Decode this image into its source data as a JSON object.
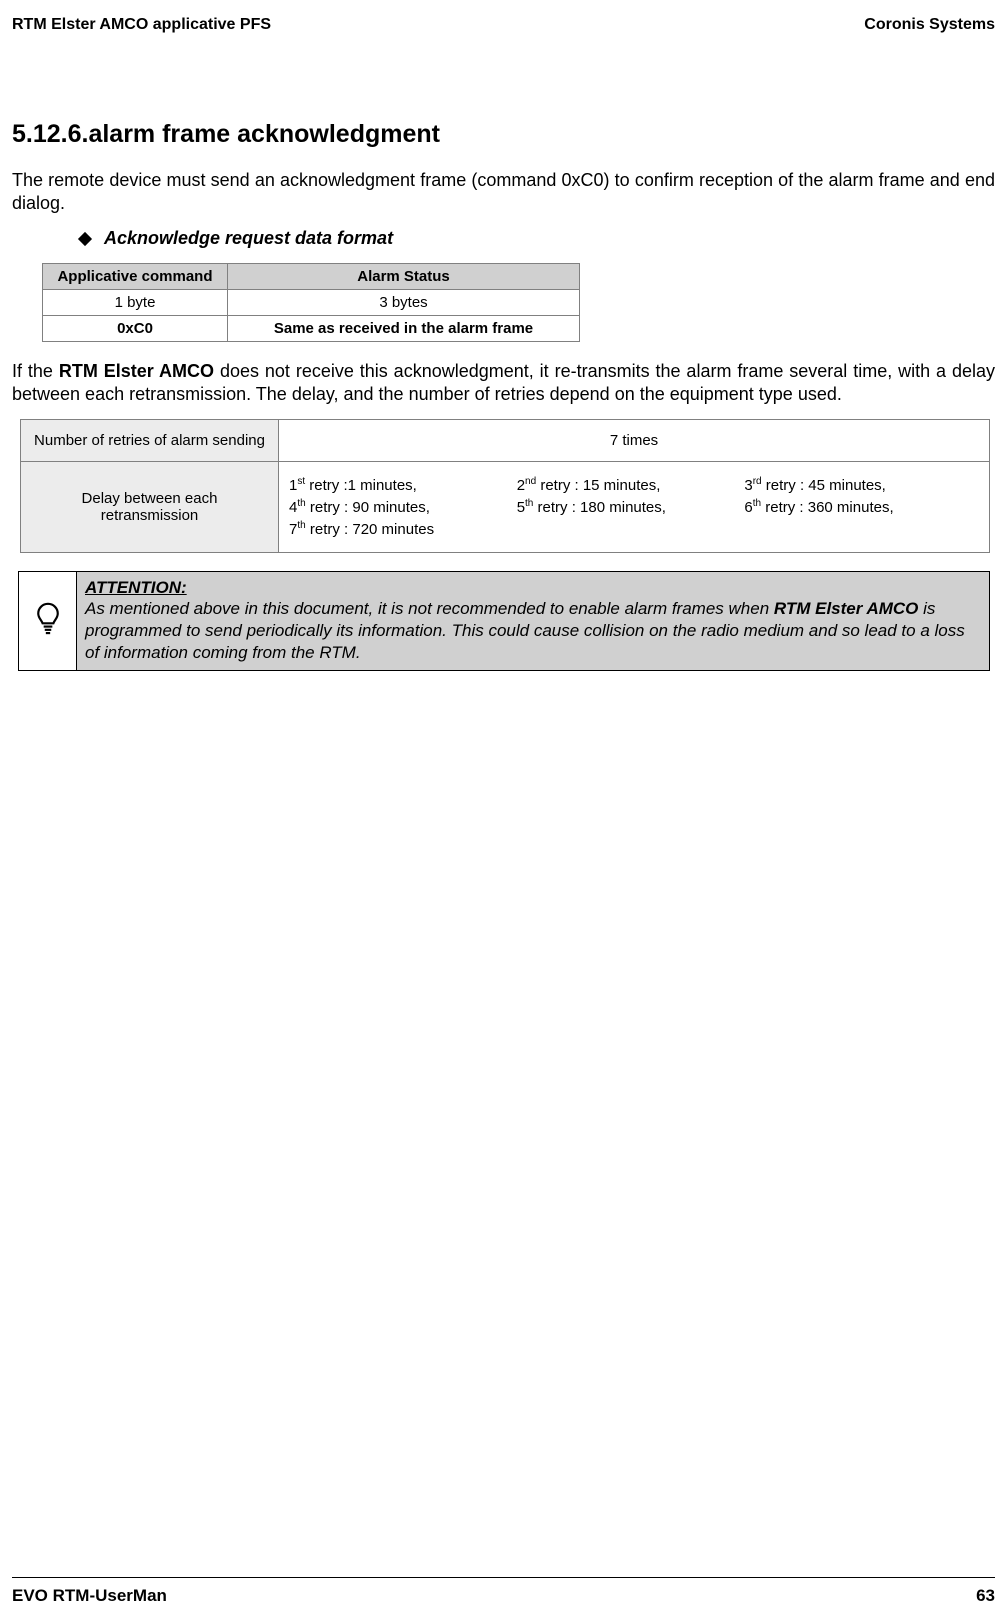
{
  "header": {
    "left": "RTM Elster AMCO applicative PFS",
    "right": "Coronis Systems"
  },
  "section": {
    "heading": "5.12.6.alarm frame acknowledgment"
  },
  "para1": "The remote device must send an acknowledgment frame (command 0xC0) to confirm reception of the alarm frame and end dialog.",
  "bullet": {
    "text": "Acknowledge request data format"
  },
  "table1": {
    "h1": "Applicative command",
    "h2": "Alarm Status",
    "r1c1": "1 byte",
    "r1c2": "3 bytes",
    "r2c1": "0xC0",
    "r2c2": "Same as received in the alarm frame"
  },
  "para2_pre": "If the ",
  "para2_bold": "RTM Elster AMCO",
  "para2_post": " does not receive this acknowledgment, it re-transmits the alarm frame several time, with a delay between each retransmission. The delay, and the number of retries depend on the equipment type used.",
  "table2": {
    "row1_label": "Number of retries of alarm sending",
    "row1_value": "7 times",
    "row2_label": "Delay between each retransmission",
    "retries": {
      "r1": {
        "ord": "st",
        "n": "1",
        "txt": " retry :1 minutes,"
      },
      "r2": {
        "ord": "nd",
        "n": "2",
        "txt": " retry : 15 minutes,"
      },
      "r3": {
        "ord": "rd",
        "n": "3",
        "txt": " retry : 45 minutes,"
      },
      "r4": {
        "ord": "th",
        "n": "4",
        "txt": " retry : 90 minutes,"
      },
      "r5": {
        "ord": "th",
        "n": "5",
        "txt": " retry : 180 minutes,"
      },
      "r6": {
        "ord": "th",
        "n": "6",
        "txt": " retry : 360 minutes,"
      },
      "r7": {
        "ord": "th",
        "n": "7",
        "txt": " retry : 720 minutes"
      }
    }
  },
  "note": {
    "title": "ATTENTION:",
    "body_pre": "As mentioned above in this document, it is not recommended to enable alarm frames when ",
    "body_bold": "RTM Elster AMCO",
    "body_post": " is programmed to send periodically its information. This could cause collision on the radio medium and so lead to a loss of information coming from the RTM."
  },
  "footer": {
    "left": "EVO RTM-UserMan",
    "right": "63"
  },
  "icons": {
    "bulb": "lightbulb-icon"
  }
}
